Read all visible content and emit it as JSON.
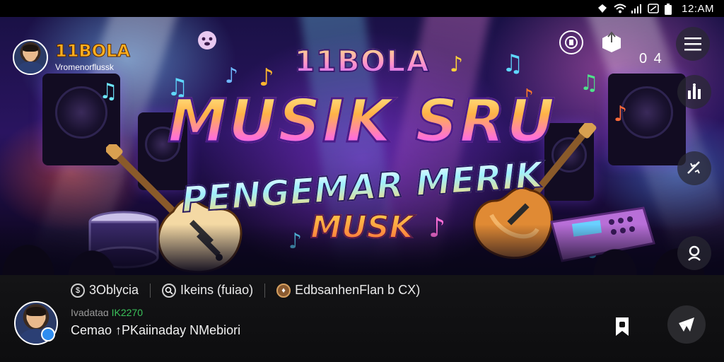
{
  "status_bar": {
    "time": "12:AM",
    "icons": [
      "location-icon",
      "wifi-icon",
      "signal-icon",
      "nfc-icon",
      "battery-icon"
    ]
  },
  "banner": {
    "channel": {
      "name": "11BOLA",
      "subtitle": "Vromenorflussk"
    },
    "title_small": "11BOLA",
    "title_main": "MUSIK SRU",
    "title_sub": "PENGEMAR MERIK",
    "title_sub2": "MUSK",
    "top_count": "0 4",
    "icons": {
      "emoji": "smiley-icon",
      "cast": "cast-icon",
      "share": "share-box-icon",
      "menu": "menu-icon",
      "stats": "stats-icon",
      "sparkle": "sparkle-icon",
      "profile": "profile-icon"
    }
  },
  "info": {
    "tags": [
      {
        "icon": "coin-icon",
        "label": "3Oblycia"
      },
      {
        "icon": "search-icon",
        "label": "Ikeins (fuiao)"
      },
      {
        "icon": "emblem-icon",
        "label": "EdbsanhenFlan b CX)"
      }
    ],
    "meta_prefix": "Ivadataɑ",
    "meta_highlight": "IK2270",
    "description": "Cemao ↑PKaiinaday NMebiori"
  },
  "colors": {
    "accent_orange": "#ffb020",
    "panel_bg": "#0d0d0f",
    "verified_blue": "#2f8df0",
    "meta_green": "#3ac25a"
  }
}
